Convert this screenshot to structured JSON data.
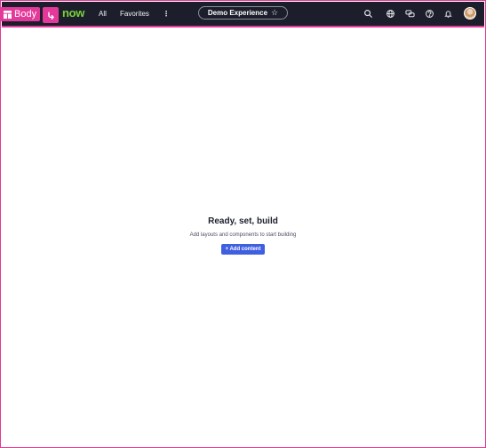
{
  "overlay": {
    "body_badge_label": "Body",
    "body_badge_icon": "layout-grid-icon",
    "link_badge_icon": "link-icon",
    "accent_color": "#e3399a"
  },
  "header": {
    "brand_text": "now",
    "brand_color": "#7ad03a",
    "background_color": "#1c1f2b",
    "nav": {
      "all_label": "All",
      "favorites_label": "Favorites",
      "more_label": "⋮"
    },
    "experience_pill": {
      "label": "Demo Experience",
      "star": "☆"
    },
    "icons": [
      "search-icon",
      "globe-icon",
      "chat-icon",
      "help-icon",
      "bell-icon",
      "avatar"
    ]
  },
  "empty_state": {
    "title": "Ready, set, build",
    "subtitle": "Add layouts and components to start building",
    "button_label": "+ Add content",
    "button_color": "#3f5fe0"
  }
}
